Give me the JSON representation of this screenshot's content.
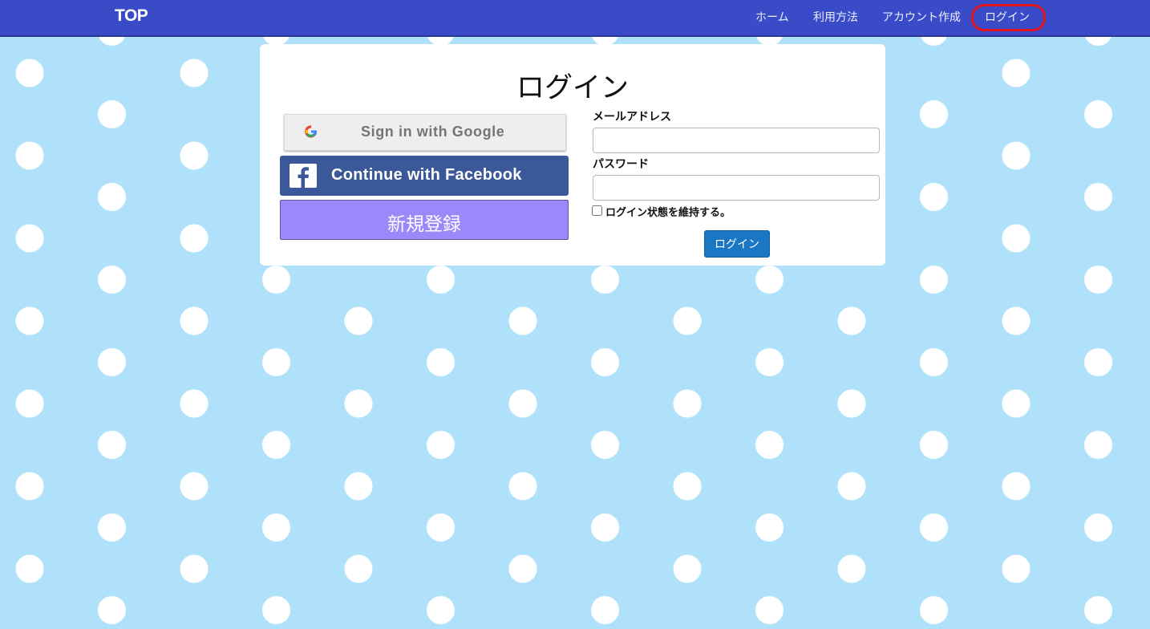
{
  "navbar": {
    "brand": "TOP",
    "links": [
      "ホーム",
      "利用方法",
      "アカウント作成",
      "ログイン"
    ],
    "highlight_color": "#e8141b",
    "background": "#3a4bc7"
  },
  "login_card": {
    "title": "ログイン",
    "google_button": {
      "label": "Sign in with Google",
      "icon": "google-g-icon"
    },
    "facebook_button": {
      "label": "Continue with Facebook",
      "icon": "facebook-f-icon"
    },
    "register_button": {
      "label": "新規登録"
    },
    "email": {
      "label": "メールアドレス",
      "value": "",
      "placeholder": ""
    },
    "password": {
      "label": "パスワード",
      "value": "",
      "placeholder": ""
    },
    "remember": {
      "label": "ログイン状態を維持する。",
      "checked": false
    },
    "submit_label": "ログイン"
  },
  "colors": {
    "background": "#afe2fa",
    "polka_dot": "#ffffff",
    "facebook": "#3b5998",
    "register": "#9b89fb",
    "submit": "#1a77c4"
  }
}
